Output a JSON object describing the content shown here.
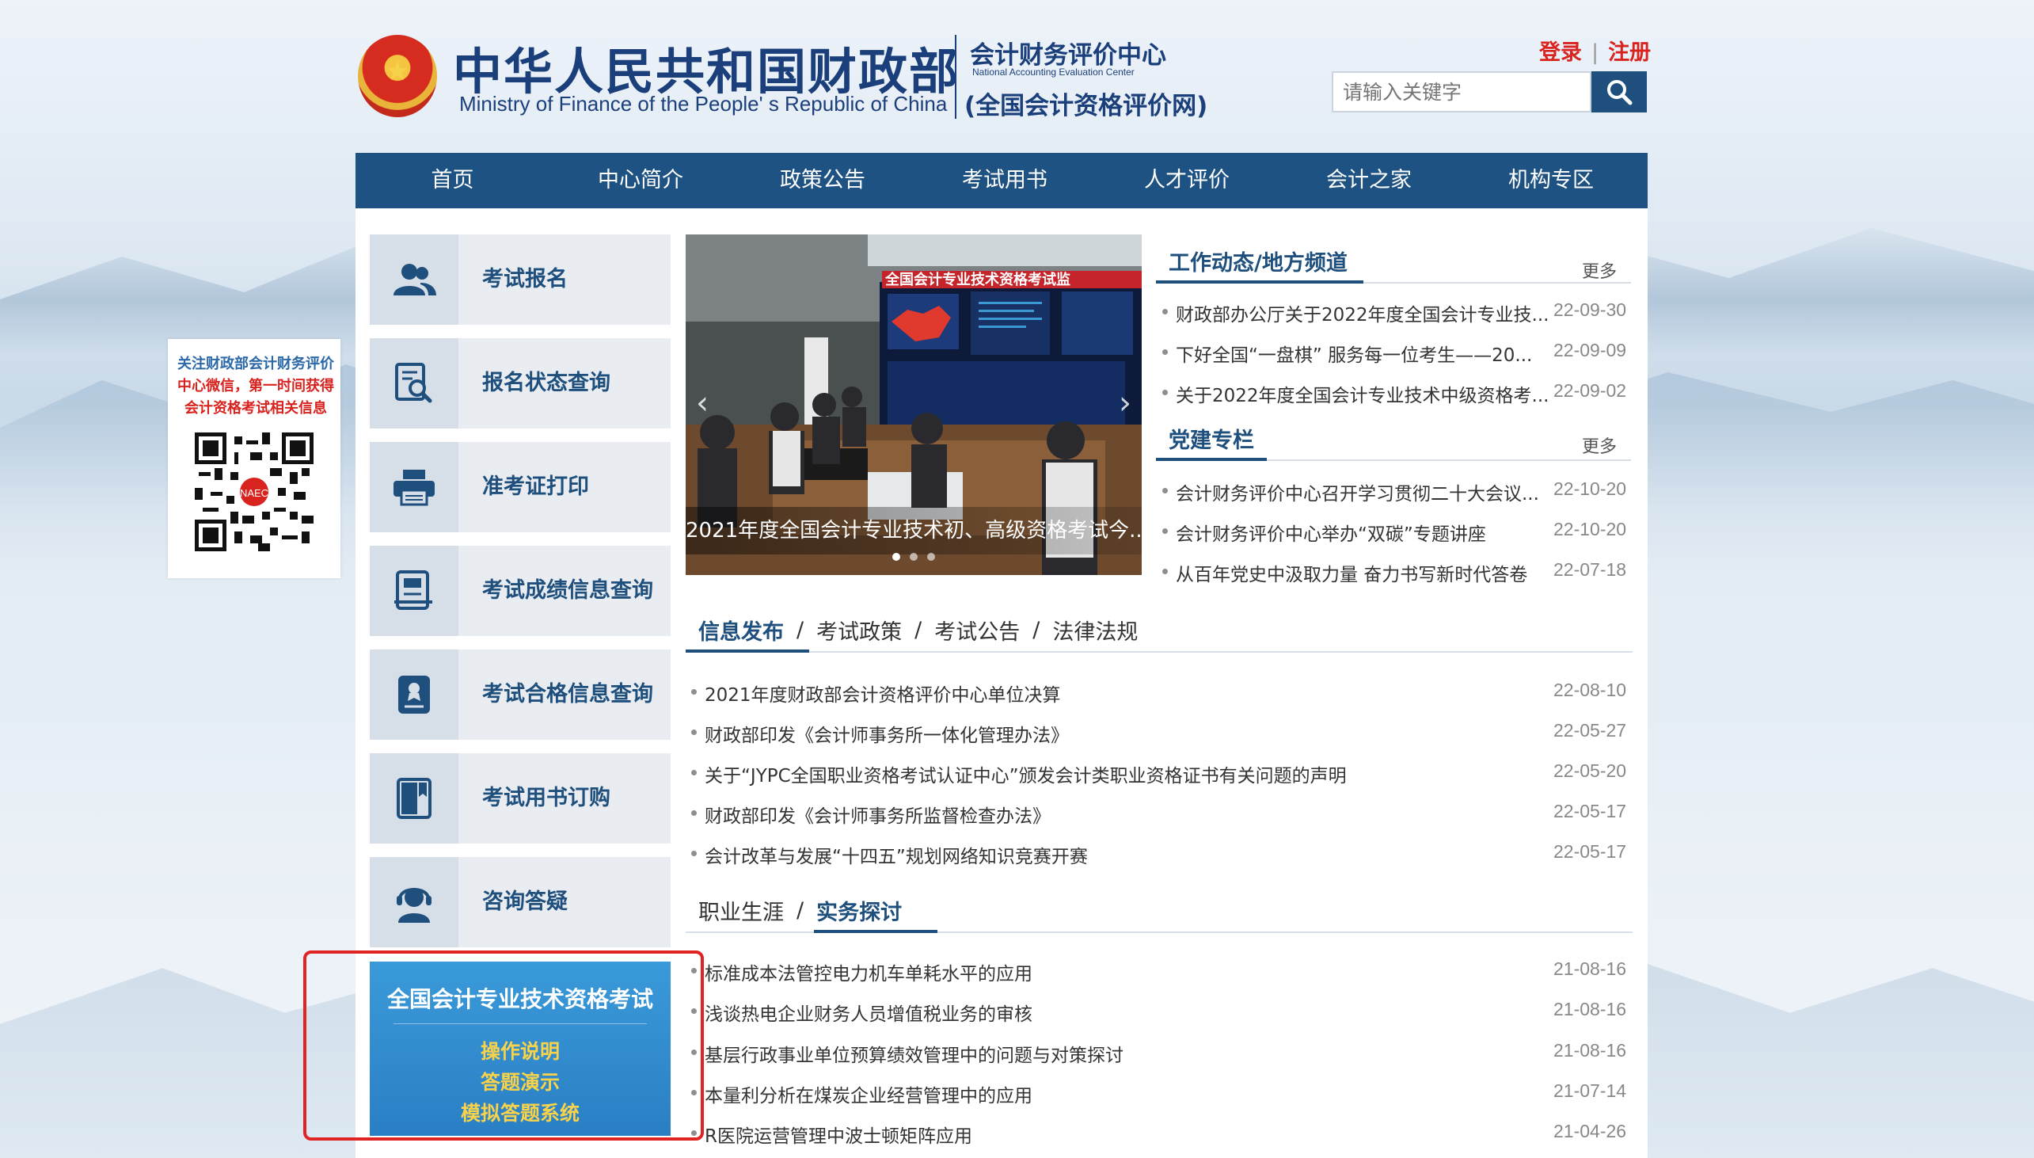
{
  "header": {
    "title_cn": "中华人民共和国财政部",
    "title_en": "Ministry of Finance of the People' s Republic of China",
    "center_cn": "会计财务评价中心",
    "center_en": "National Accounting Evaluation Center",
    "net_cn": "(全国会计资格评价网)",
    "login": "登录",
    "register": "注册",
    "search_placeholder": "请输入关键字",
    "search_icon": "search-icon",
    "emblem_icon": "national-emblem"
  },
  "nav": [
    "首页",
    "中心简介",
    "政策公告",
    "考试用书",
    "人才评价",
    "会计之家",
    "机构专区"
  ],
  "qr": {
    "line1": "关注财政部会计财务评价",
    "line2": "中心微信，第一时间获得",
    "line3": "会计资格考试相关信息",
    "logo_text": "NAEC"
  },
  "services": [
    {
      "label": "考试报名",
      "icon": "users-icon"
    },
    {
      "label": "报名状态查询",
      "icon": "search-doc-icon"
    },
    {
      "label": "准考证打印",
      "icon": "printer-icon"
    },
    {
      "label": "考试成绩信息查询",
      "icon": "score-doc-icon"
    },
    {
      "label": "考试合格信息查询",
      "icon": "certificate-icon"
    },
    {
      "label": "考试用书订购",
      "icon": "book-icon"
    },
    {
      "label": "咨询答疑",
      "icon": "headset-icon"
    }
  ],
  "promo": {
    "title": "全国会计专业技术资格考试",
    "lines": [
      "操作说明",
      "答题演示",
      "模拟答题系统"
    ]
  },
  "slide": {
    "caption": "2021年度全国会计专业技术初、高级资格考试今...",
    "screen_banner": "全国会计专业技术资格考试监"
  },
  "work": {
    "title": "工作动态/地方频道",
    "more": "更多",
    "items": [
      {
        "text": "财政部办公厅关于2022年度全国会计专业技...",
        "date": "22-09-30"
      },
      {
        "text": "下好全国“一盘棋” 服务每一位考生——20...",
        "date": "22-09-09"
      },
      {
        "text": "关于2022年度全国会计专业技术中级资格考...",
        "date": "22-09-02"
      }
    ]
  },
  "party": {
    "title": "党建专栏",
    "more": "更多",
    "items": [
      {
        "text": "会计财务评价中心召开学习贯彻二十大会议...",
        "date": "22-10-20"
      },
      {
        "text": "会计财务评价中心举办“双碳”专题讲座",
        "date": "22-10-20"
      },
      {
        "text": "从百年党史中汲取力量 奋力书写新时代答卷",
        "date": "22-07-18"
      }
    ]
  },
  "info": {
    "tabs": [
      "信息发布",
      "考试政策",
      "考试公告",
      "法律法规"
    ],
    "items": [
      {
        "text": "2021年度财政部会计资格评价中心单位决算",
        "date": "22-08-10"
      },
      {
        "text": "财政部印发《会计师事务所一体化管理办法》",
        "date": "22-05-27"
      },
      {
        "text": "关于“JYPC全国职业资格考试认证中心”颁发会计类职业资格证书有关问题的声明",
        "date": "22-05-20"
      },
      {
        "text": "财政部印发《会计师事务所监督检查办法》",
        "date": "22-05-17"
      },
      {
        "text": "会计改革与发展“十四五”规划网络知识竞赛开赛",
        "date": "22-05-17"
      }
    ]
  },
  "practice": {
    "tabs": [
      "职业生涯",
      "实务探讨"
    ],
    "items": [
      {
        "text": "标准成本法管控电力机车单耗水平的应用",
        "date": "21-08-16"
      },
      {
        "text": "浅谈热电企业财务人员增值税业务的审核",
        "date": "21-08-16"
      },
      {
        "text": "基层行政事业单位预算绩效管理中的问题与对策探讨",
        "date": "21-08-16"
      },
      {
        "text": "本量利分析在煤炭企业经营管理中的应用",
        "date": "21-07-14"
      },
      {
        "text": "R医院运营管理中波士顿矩阵应用",
        "date": "21-04-26"
      }
    ]
  },
  "colors": {
    "nav_bg": "#1e5282",
    "brand_blue": "#1b3f7a",
    "accent_red": "#d8231f",
    "highlight_frame": "#e02424",
    "promo_gold": "#f8d24a"
  }
}
